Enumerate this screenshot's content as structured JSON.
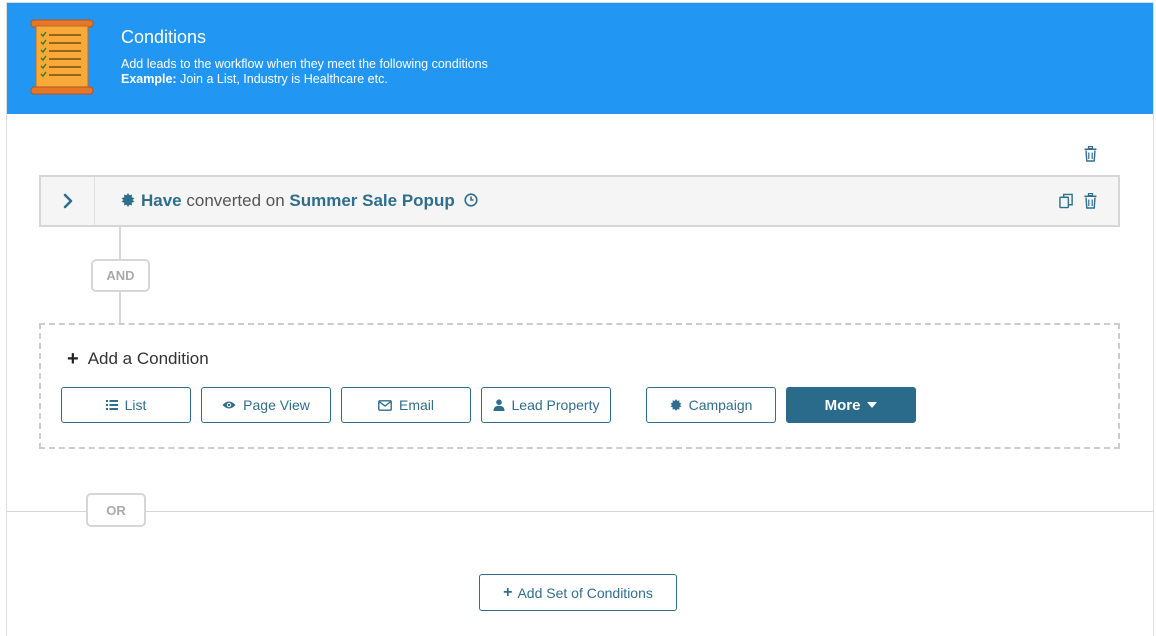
{
  "header": {
    "title": "Conditions",
    "description": "Add leads to the workflow when they meet the following conditions",
    "example_label": "Example:",
    "example_text": " Join a List, Industry is Healthcare etc."
  },
  "condition": {
    "verb": "Have",
    "action": " converted on ",
    "target": "Summer Sale Popup"
  },
  "connectors": {
    "and_label": "AND",
    "or_label": "OR"
  },
  "add_condition": {
    "title": "Add a Condition",
    "options": [
      {
        "label": "List",
        "icon": "list-icon"
      },
      {
        "label": "Page View",
        "icon": "eye-icon"
      },
      {
        "label": "Email",
        "icon": "envelope-icon"
      },
      {
        "label": "Lead Property",
        "icon": "user-icon"
      },
      {
        "label": "Campaign",
        "icon": "badge-icon"
      },
      {
        "label": "More",
        "icon": "caret-down-icon"
      }
    ]
  },
  "add_set_label": "Add Set of Conditions",
  "colors": {
    "header_bg": "#2196f3",
    "accent": "#2f6e8c",
    "more_bg": "#2a6b8c",
    "border": "#d6d6d6"
  }
}
